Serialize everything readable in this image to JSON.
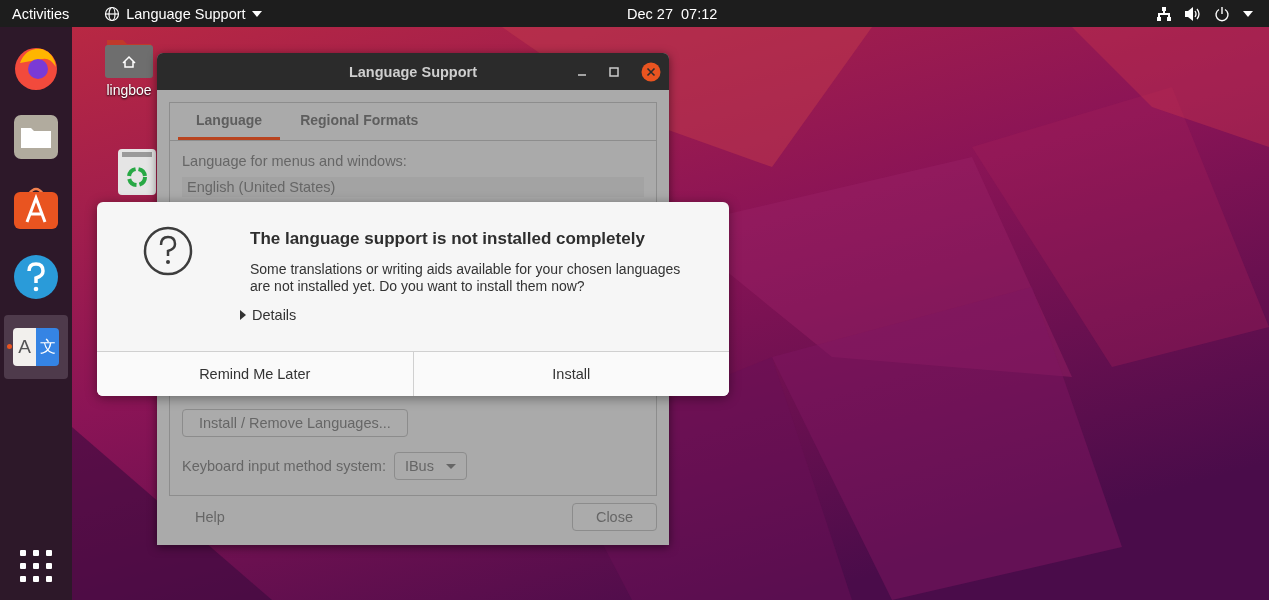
{
  "topbar": {
    "activities": "Activities",
    "app_menu": "Language Support",
    "clock": "Dec 27  07:12"
  },
  "dock": {
    "items": [
      {
        "kind": "firefox",
        "running": false,
        "selected": false
      },
      {
        "kind": "files",
        "running": false,
        "selected": false
      },
      {
        "kind": "store",
        "running": false,
        "selected": false
      },
      {
        "kind": "help",
        "running": false,
        "selected": false
      },
      {
        "kind": "language",
        "running": true,
        "selected": true,
        "glyphs": [
          "A",
          "文"
        ]
      }
    ]
  },
  "desktop_icons": [
    {
      "kind": "home",
      "label": "lingboe"
    },
    {
      "kind": "trash"
    }
  ],
  "window": {
    "title": "Language Support",
    "tabs": [
      {
        "label": "Language",
        "selected": true
      },
      {
        "label": "Regional Formats",
        "selected": false
      }
    ],
    "language_label": "Language for menus and windows:",
    "languages": [
      "English (United States)"
    ],
    "install_button": "Install / Remove Languages...",
    "keyboard_label": "Keyboard input method system:",
    "input_method": "IBus",
    "help_button": "Help",
    "close_button": "Close"
  },
  "dialog": {
    "title": "The language support is not installed completely",
    "message": "Some translations or writing aids available for your chosen languages are not installed yet. Do you want to install them now?",
    "details": {
      "label": "Details",
      "expanded": false
    },
    "buttons": [
      "Remind Me Later",
      "Install"
    ]
  }
}
